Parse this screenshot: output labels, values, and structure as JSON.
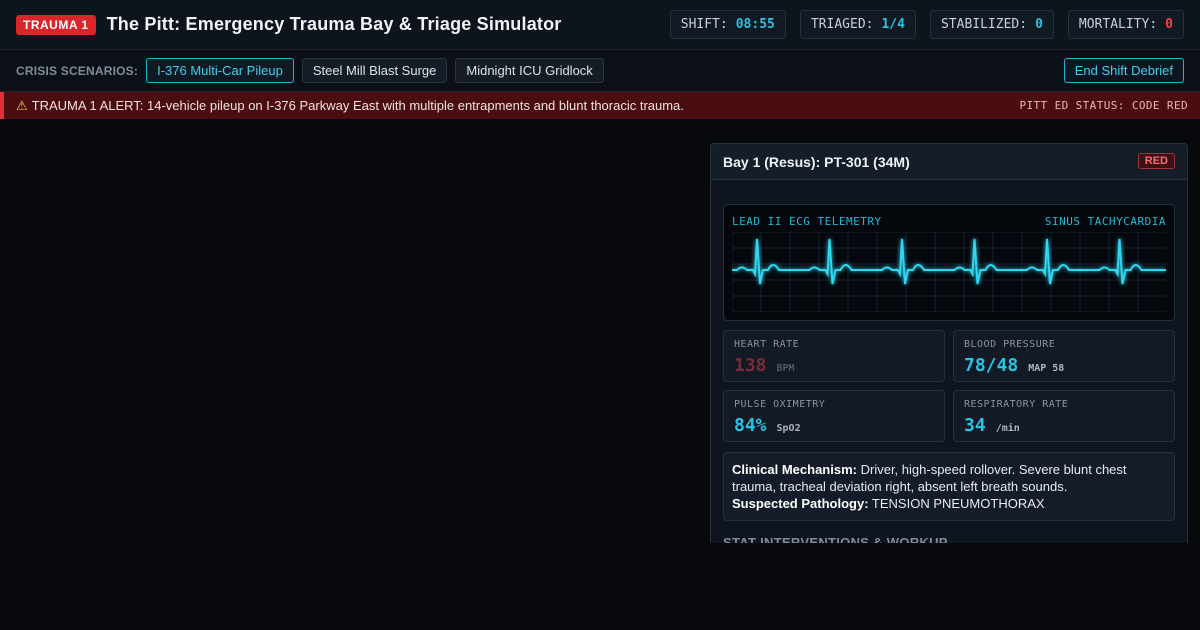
{
  "header": {
    "badge": "TRAUMA 1",
    "title": "The Pitt: Emergency Trauma Bay & Triage Simulator",
    "stats": [
      {
        "label": "SHIFT:",
        "value": "08:55"
      },
      {
        "label": "TRIAGED:",
        "value": "1/4"
      },
      {
        "label": "STABILIZED:",
        "value": "0"
      },
      {
        "label": "MORTALITY:",
        "value": "0"
      }
    ]
  },
  "scenarios": {
    "label": "CRISIS SCENARIOS:",
    "items": [
      "I-376 Multi-Car Pileup",
      "Steel Mill Blast Surge",
      "Midnight ICU Gridlock"
    ],
    "debrief_label": "End Shift Debrief"
  },
  "alert": {
    "text": "TRAUMA 1 ALERT: 14-vehicle pileup on I-376 Parkway East with multiple entrapments and blunt thoracic trauma.",
    "status": "PITT ED STATUS: CODE RED"
  },
  "bay": {
    "title": "Bay 1 (Resus): PT-301 (34M)",
    "triage": "RED",
    "ecg": {
      "label": "LEAD II ECG TELEMETRY",
      "rhythm": "SINUS TACHYCARDIA"
    },
    "vitals": [
      {
        "label": "HEART RATE",
        "value": "138",
        "unit": "BPM"
      },
      {
        "label": "BLOOD PRESSURE",
        "value": "78/48",
        "unit": "MAP 58"
      },
      {
        "label": "PULSE OXIMETRY",
        "value": "84%",
        "unit": "SpO2"
      },
      {
        "label": "RESPIRATORY RATE",
        "value": "34",
        "unit": "/min"
      }
    ],
    "clinical": {
      "mechanism_label": "Clinical Mechanism:",
      "mechanism": "Driver, high-speed rollover. Severe blunt chest trauma, tracheal deviation right, absent left breath sounds.",
      "pathology_label": "Suspected Pathology:",
      "pathology": "TENSION PNEUMOTHORAX"
    },
    "section_title": "STAT INTERVENTIONS & WORKUP"
  },
  "colors": {
    "accent": "#27c4e0",
    "alert": "#d9262b",
    "background": "#07090d"
  },
  "icons": {
    "alert": "warning-icon"
  }
}
